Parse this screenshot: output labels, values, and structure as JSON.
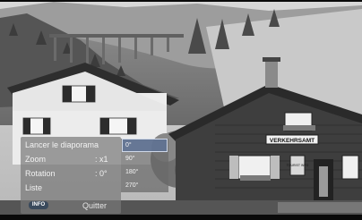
{
  "scene": {
    "sign_text": "VERKEHRSAMT",
    "small_sign_text": "TOURIST INFO"
  },
  "menu": {
    "items": [
      {
        "label": "Lancer le diaporama",
        "value": ""
      },
      {
        "label": "Zoom",
        "value": ": x1"
      },
      {
        "label": "Rotation",
        "value": ": 0°"
      },
      {
        "label": "Liste",
        "value": ""
      }
    ],
    "info_key": "INFO",
    "quit_label": "Quitter"
  },
  "rotation_options": [
    {
      "label": "0°",
      "selected": true
    },
    {
      "label": "90°",
      "selected": false
    },
    {
      "label": "180°",
      "selected": false
    },
    {
      "label": "270°",
      "selected": false
    }
  ]
}
